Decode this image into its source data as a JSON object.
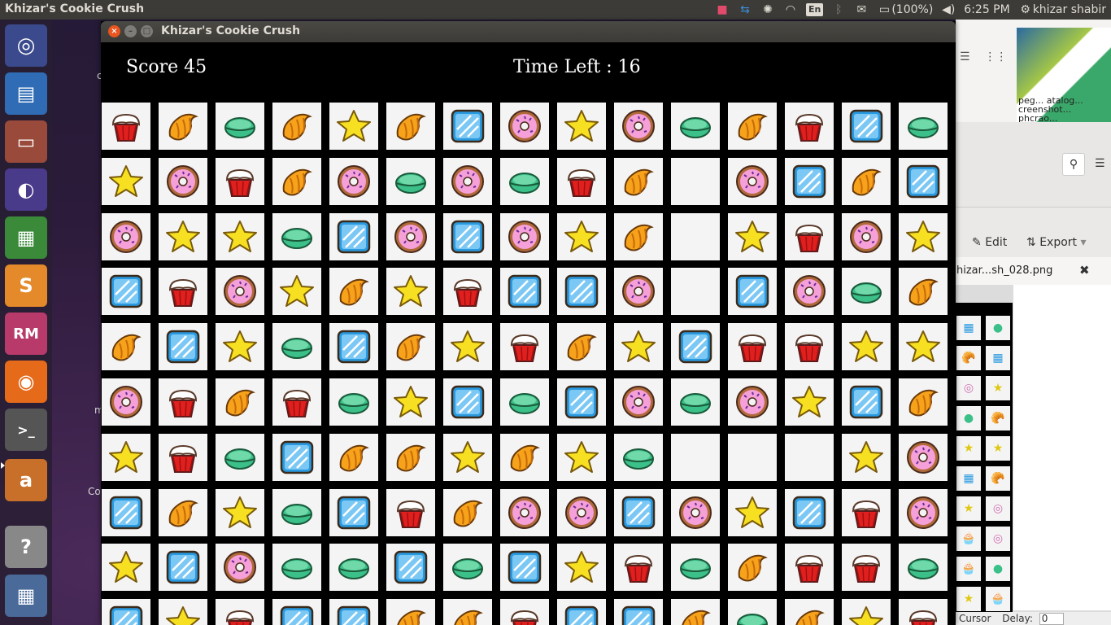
{
  "top_panel": {
    "app_name": "Khizar's Cookie Crush",
    "keyboard_layout": "En",
    "battery": "(100%)",
    "clock": "6:25 PM",
    "user": "khizar shabir"
  },
  "window": {
    "title": "Khizar's Cookie Crush"
  },
  "game": {
    "score_label": "Score 45",
    "time_label": "Time Left : 16",
    "grid": [
      [
        "cupcake",
        "croissant",
        "macaron",
        "croissant",
        "star",
        "croissant",
        "candy",
        "donut",
        "star",
        "donut",
        "macaron",
        "croissant",
        "cupcake",
        "candy",
        "macaron"
      ],
      [
        "star",
        "donut",
        "cupcake",
        "croissant",
        "donut",
        "macaron",
        "donut",
        "macaron",
        "cupcake",
        "croissant",
        "empty",
        "donut",
        "candy",
        "croissant",
        "candy"
      ],
      [
        "donut",
        "star",
        "star",
        "macaron",
        "candy",
        "donut",
        "candy",
        "donut",
        "star",
        "croissant",
        "empty",
        "star",
        "cupcake",
        "donut",
        "star"
      ],
      [
        "candy",
        "cupcake",
        "donut",
        "star",
        "croissant",
        "star",
        "cupcake",
        "candy",
        "candy",
        "donut",
        "empty",
        "candy",
        "donut",
        "macaron",
        "croissant"
      ],
      [
        "croissant",
        "candy",
        "star",
        "macaron",
        "candy",
        "croissant",
        "star",
        "cupcake",
        "croissant",
        "star",
        "candy",
        "cupcake",
        "cupcake",
        "star",
        "star"
      ],
      [
        "donut",
        "cupcake",
        "croissant",
        "cupcake",
        "macaron",
        "star",
        "candy",
        "macaron",
        "candy",
        "donut",
        "macaron",
        "donut",
        "star",
        "candy",
        "croissant"
      ],
      [
        "star",
        "cupcake",
        "macaron",
        "candy",
        "croissant",
        "croissant",
        "star",
        "croissant",
        "star",
        "macaron",
        "empty",
        "empty",
        "empty",
        "star",
        "donut"
      ],
      [
        "candy",
        "croissant",
        "star",
        "macaron",
        "candy",
        "cupcake",
        "croissant",
        "donut",
        "donut",
        "candy",
        "donut",
        "star",
        "candy",
        "cupcake",
        "donut"
      ],
      [
        "star",
        "candy",
        "donut",
        "macaron",
        "macaron",
        "candy",
        "macaron",
        "candy",
        "star",
        "cupcake",
        "macaron",
        "croissant",
        "cupcake",
        "cupcake",
        "macaron"
      ],
      [
        "candy",
        "star",
        "cupcake",
        "candy",
        "candy",
        "croissant",
        "croissant",
        "cupcake",
        "candy",
        "candy",
        "croissant",
        "macaron",
        "croissant",
        "star",
        "cupcake"
      ]
    ]
  },
  "background_window": {
    "thumb_caption": "peg... atalog... creenshot... phcrao...",
    "edit_label": "Edit",
    "export_label": "Export",
    "tab_label": "hizar...sh_028.png",
    "status_cursor": "Cursor",
    "status_delay": "Delay:",
    "status_delay_value": "0"
  },
  "mini_board": [
    [
      "candy",
      "macaron"
    ],
    [
      "croissant",
      "candy"
    ],
    [
      "donut",
      "star"
    ],
    [
      "macaron",
      "croissant"
    ],
    [
      "star",
      "star"
    ],
    [
      "candy",
      "croissant"
    ],
    [
      "star",
      "donut"
    ],
    [
      "cupcake",
      "donut"
    ],
    [
      "cupcake",
      "macaron"
    ],
    [
      "star",
      "cupcake"
    ]
  ],
  "launcher": [
    "ubuntu-icon",
    "writer-icon",
    "file-manager-icon",
    "eclipse-icon",
    "calc-icon",
    "sublime-icon",
    "rubymine-icon",
    "firefox-icon",
    "terminal-icon",
    "amazon-icon",
    "help-icon",
    "workspace-icon"
  ],
  "desktop_labels": [
    "c",
    "m",
    "Co"
  ],
  "colors": {
    "panel": "#3c3b37",
    "board_bg": "#000000",
    "cell_bg": "#f4f4f4",
    "close_button": "#e9541f"
  }
}
